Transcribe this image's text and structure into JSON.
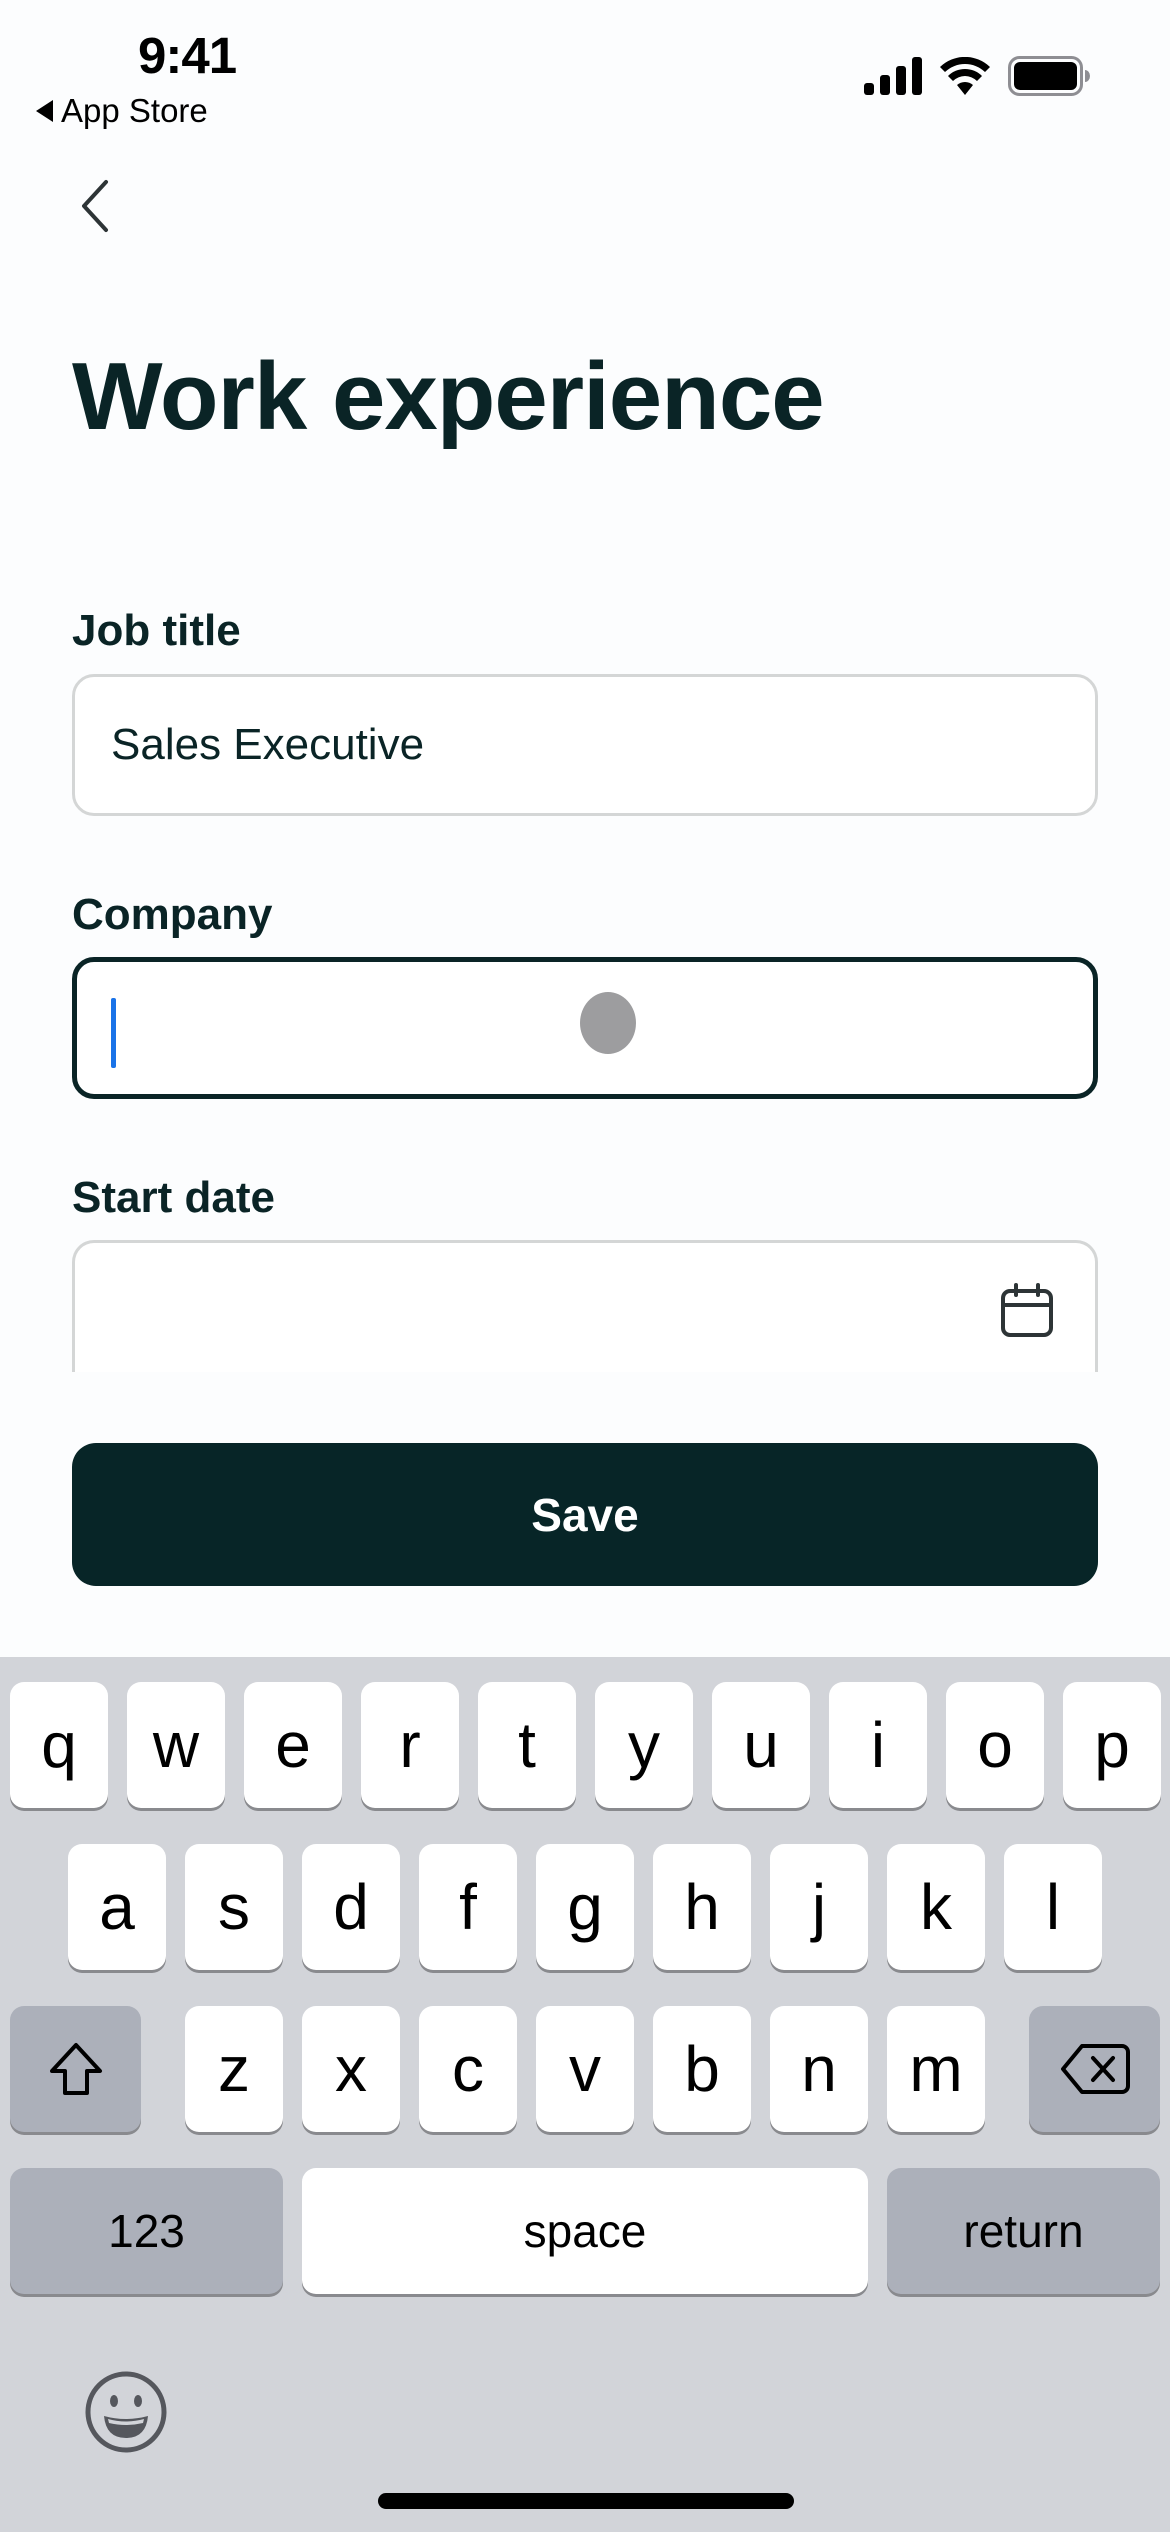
{
  "status_bar": {
    "time": "9:41",
    "back_app": "App Store",
    "icons": [
      "cellular-signal-icon",
      "wifi-icon",
      "battery-icon"
    ]
  },
  "nav": {
    "back_icon": "chevron-left-icon"
  },
  "page": {
    "title": "Work experience"
  },
  "form": {
    "job_title": {
      "label": "Job title",
      "value": "Sales Executive"
    },
    "company": {
      "label": "Company",
      "value": "",
      "state": "focused"
    },
    "start_date": {
      "label": "Start date",
      "value": "",
      "icon": "calendar-icon"
    }
  },
  "actions": {
    "save_label": "Save"
  },
  "colors": {
    "primary": "#072527",
    "text": "#0a2426",
    "caret": "#1a73e8",
    "field_border": "#d4d6d6",
    "keyboard_bg": "#d2d4d9"
  },
  "keyboard": {
    "row1": [
      "q",
      "w",
      "e",
      "r",
      "t",
      "y",
      "u",
      "i",
      "o",
      "p"
    ],
    "row2": [
      "a",
      "s",
      "d",
      "f",
      "g",
      "h",
      "j",
      "k",
      "l"
    ],
    "row3": [
      "z",
      "x",
      "c",
      "v",
      "b",
      "n",
      "m"
    ],
    "shift_icon": "shift-icon",
    "delete_icon": "delete-backspace-icon",
    "numbers_label": "123",
    "space_label": "space",
    "return_label": "return",
    "emoji_icon": "emoji-icon"
  }
}
